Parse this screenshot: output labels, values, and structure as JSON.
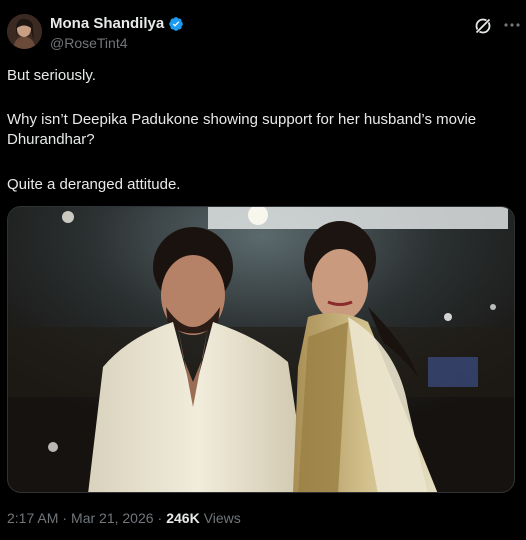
{
  "post": {
    "author": {
      "display_name": "Mona Shandilya",
      "handle": "@RoseTint4",
      "verified": true,
      "verified_color": "#1d9bf0"
    },
    "paragraphs": [
      "But seriously.",
      "Why isn’t Deepika Padukone showing support for her husband’s movie Dhurandhar?",
      "Quite a deranged attitude."
    ],
    "meta": {
      "time": "2:17 AM",
      "separator": "·",
      "date": "Mar 21, 2026",
      "views_count": "246K",
      "views_label": "Views"
    }
  },
  "icons": {
    "grok": "grok-icon",
    "more": "more-icon",
    "verified": "verified-badge-icon"
  }
}
